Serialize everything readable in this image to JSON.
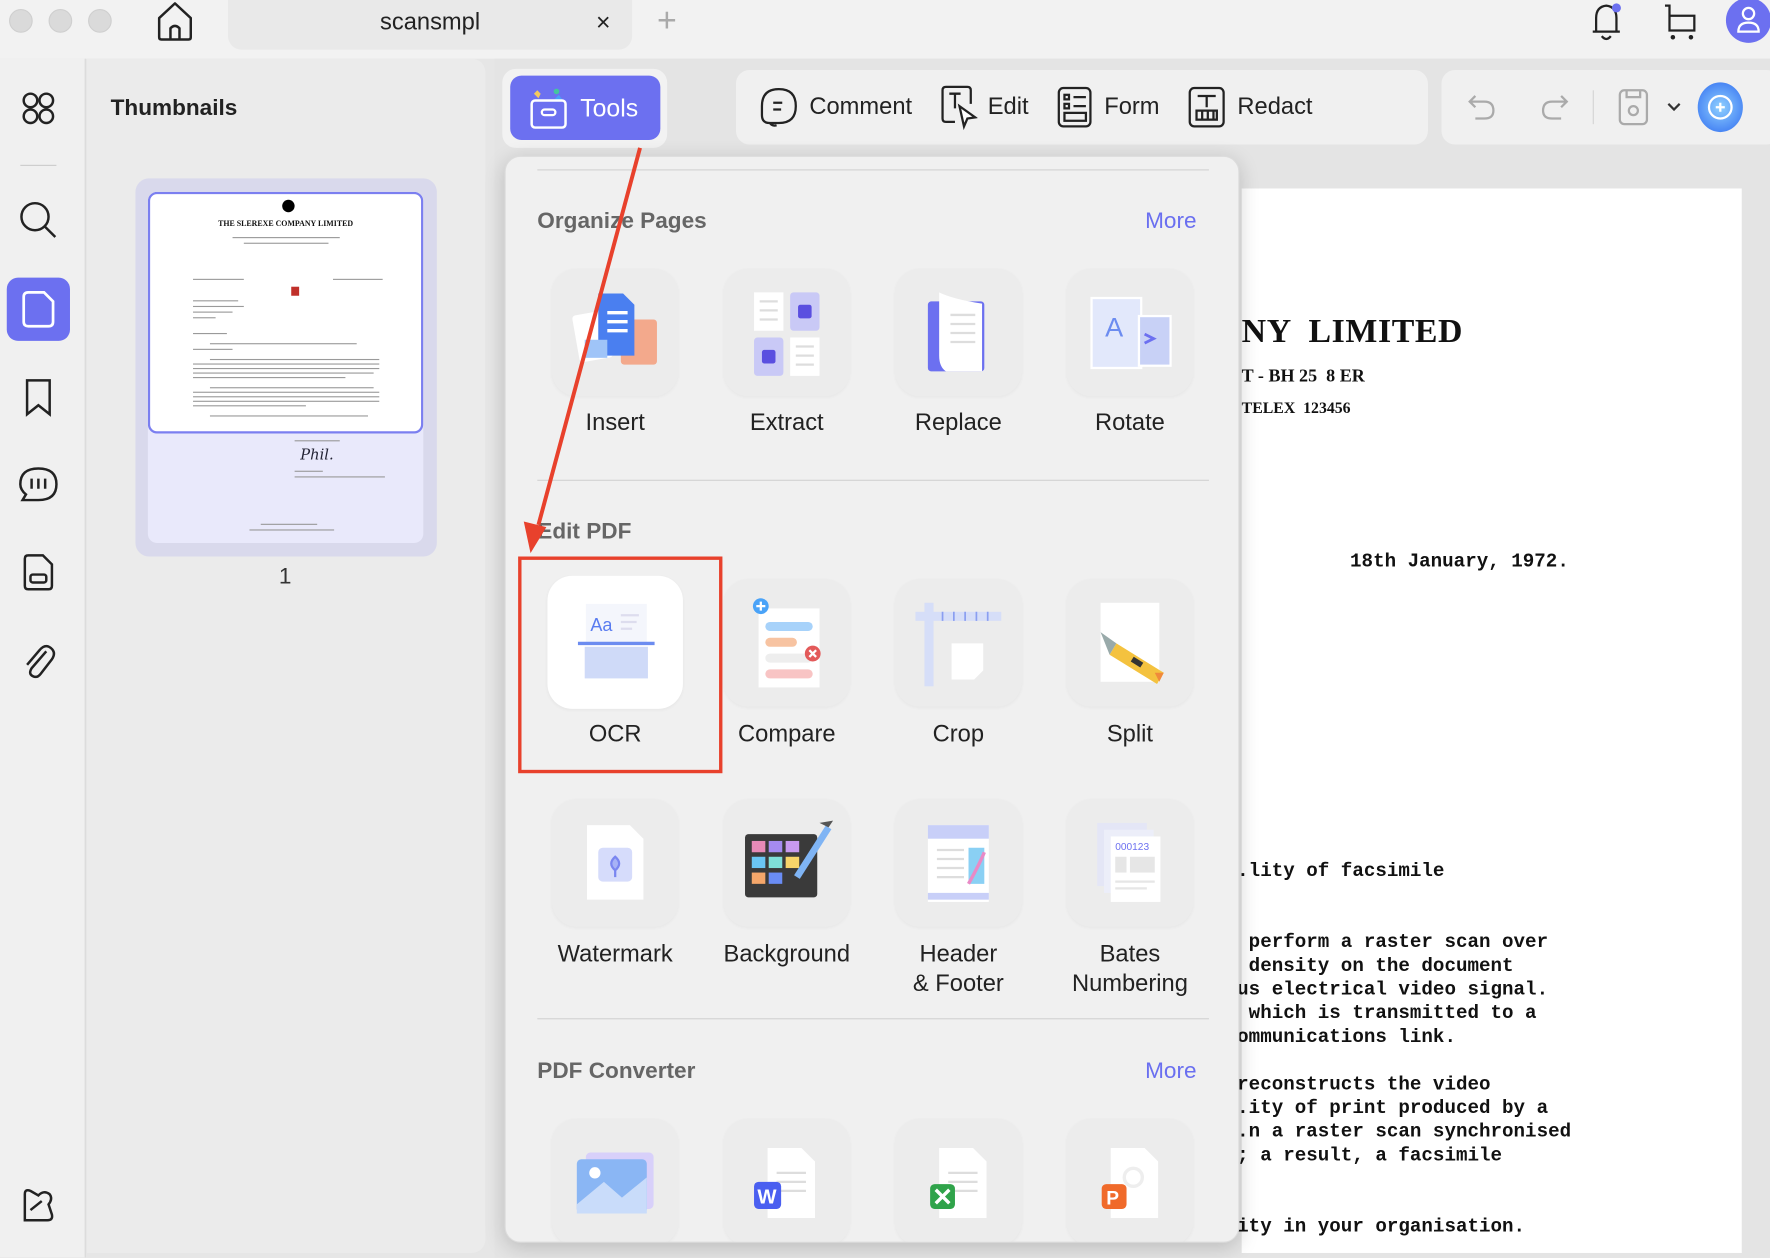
{
  "window": {
    "tab_title": "scansmpl",
    "close_tab": "×",
    "new_tab": "+"
  },
  "header_icons": [
    "home-icon",
    "bell-icon",
    "cart-icon",
    "avatar-icon"
  ],
  "sidebar_icons": [
    "grid-icon",
    "search-icon",
    "page-icon",
    "bookmark-icon",
    "comment-icon",
    "form-icon",
    "attachment-icon",
    "feather-icon"
  ],
  "thumbnails": {
    "title": "Thumbnails",
    "page_number": "1",
    "doc_heading": "THE SLEREXE COMPANY LIMITED"
  },
  "toolbar": {
    "tools": "Tools",
    "comment": "Comment",
    "edit": "Edit",
    "form": "Form",
    "redact": "Redact"
  },
  "colors": {
    "accent": "#6c70f0",
    "highlight": "#e8412c"
  },
  "tools_panel": {
    "sections": [
      {
        "title": "Organize Pages",
        "more": "More",
        "items": [
          "Insert",
          "Extract",
          "Replace",
          "Rotate"
        ]
      },
      {
        "title": "Edit PDF",
        "items": [
          "OCR",
          "Compare",
          "Crop",
          "Split",
          "Watermark",
          "Background",
          "Header\n& Footer",
          "Bates\nNumbering"
        ]
      },
      {
        "title": "PDF Converter",
        "more": "More",
        "items": [
          "To Image",
          "To Word",
          "To Excel",
          "To PowerPoint"
        ]
      }
    ],
    "bates_sample": "000123"
  },
  "document": {
    "company": "NY  LIMITED",
    "address": "T - BH 25  8 ER",
    "telex": "TELEX  123456",
    "date": "18th January, 1972.",
    "lines": [
      ".lity of facsimile",
      "",
      "",
      " perform a raster scan over",
      " density on the document",
      "us electrical video signal.",
      " which is transmitted to a",
      "ommunications link.",
      "",
      "reconstructs the video",
      ".ity of print produced by a",
      ".n a raster scan synchronised",
      "; a result, a facsimile",
      "",
      "",
      "ity in your organisation."
    ]
  }
}
